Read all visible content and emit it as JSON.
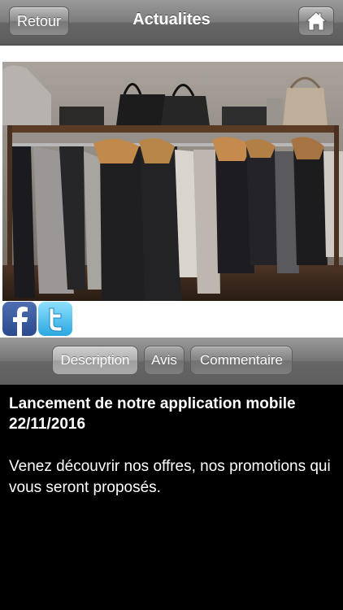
{
  "navbar": {
    "back_label": "Retour",
    "title": "Actualites",
    "home_icon": "home-icon"
  },
  "photo": {
    "description": "clothing-rack-photo"
  },
  "social": {
    "facebook_icon": "facebook-icon",
    "twitter_icon": "twitter-icon"
  },
  "tabs": [
    {
      "label": "Description",
      "active": true
    },
    {
      "label": "Avis",
      "active": false
    },
    {
      "label": "Commentaire",
      "active": false
    }
  ],
  "article": {
    "headline": "Lancement de notre application mobile 22/11/2016",
    "body": "Venez découvrir nos offres, nos promotions qui vous seront proposés."
  }
}
